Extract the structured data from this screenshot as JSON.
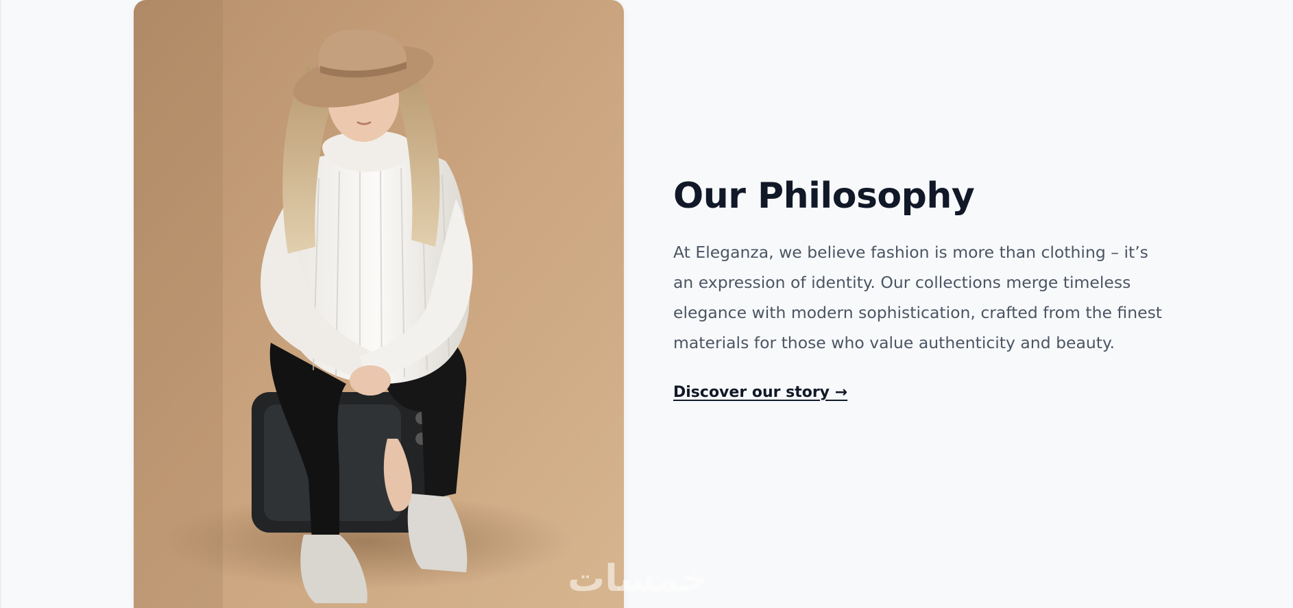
{
  "section": {
    "title": "Our Philosophy",
    "body": "At Eleganza, we believe fashion is more than clothing – it’s an expression of identity. Our collections merge timeless elegance with modern sophistication, crafted from the finest materials for those who value authenticity and beauty.",
    "link_label": "Discover our story →"
  },
  "watermark": {
    "text": "خمسات"
  },
  "colors": {
    "page_background": "#f8f9fb",
    "title": "#111827",
    "body": "#4b5563",
    "photo_backdrop": "#c9a47e"
  }
}
